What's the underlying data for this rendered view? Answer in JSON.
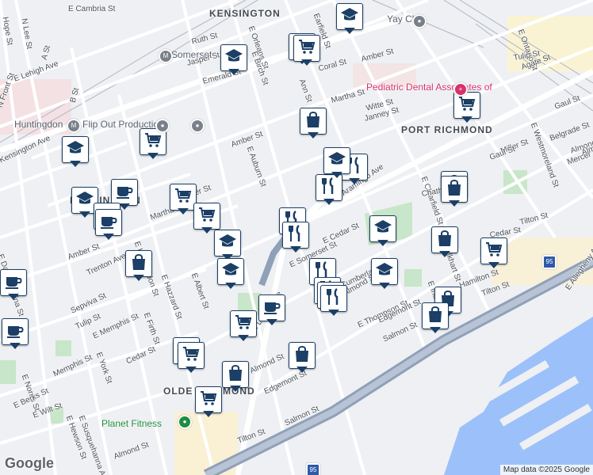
{
  "neighborhoods": [
    {
      "name": "KENSINGTON"
    },
    {
      "name": "PORT RICHMOND"
    },
    {
      "name": "KENSINGTON"
    },
    {
      "name": "OLDE RICHMOND"
    }
  ],
  "places": [
    {
      "name": "Somerset"
    },
    {
      "name": "Huntingdon"
    },
    {
      "name": "Flip Out Productions"
    },
    {
      "name": "Pediatric Dental Associates of"
    },
    {
      "name": "Yay Clay"
    },
    {
      "name": "Planet Fitness"
    }
  ],
  "streets": [
    {
      "name": "E Cambria St"
    },
    {
      "name": "N Lee St"
    },
    {
      "name": "Hope St"
    },
    {
      "name": "E Lehigh Ave"
    },
    {
      "name": "N Front St"
    },
    {
      "name": "B St"
    },
    {
      "name": "A St"
    },
    {
      "name": "Kensington Ave"
    },
    {
      "name": "Ruth St"
    },
    {
      "name": "Jasper St"
    },
    {
      "name": "Emerald St"
    },
    {
      "name": "E Orleans St"
    },
    {
      "name": "E Birch St"
    },
    {
      "name": "Coral St"
    },
    {
      "name": "Amber St"
    },
    {
      "name": "Earfield St"
    },
    {
      "name": "Ann St"
    },
    {
      "name": "E Ontario St"
    },
    {
      "name": "Tulip St"
    },
    {
      "name": "Agate St"
    },
    {
      "name": "Martha St"
    },
    {
      "name": "Witte St"
    },
    {
      "name": "Janney St"
    },
    {
      "name": "Gaul St"
    },
    {
      "name": "E Westmoreland St"
    },
    {
      "name": "Belgrade St"
    },
    {
      "name": "Almond St"
    },
    {
      "name": "Mercer St"
    },
    {
      "name": "Miller St"
    },
    {
      "name": "Aramingo Ave"
    },
    {
      "name": "E Auburn St"
    },
    {
      "name": "Amber St"
    },
    {
      "name": "Martha St"
    },
    {
      "name": "E Huntingdon St"
    },
    {
      "name": "Amber St"
    },
    {
      "name": "E Hazzard St"
    },
    {
      "name": "E Albert St"
    },
    {
      "name": "Trenton Ave"
    },
    {
      "name": "Sepviva St"
    },
    {
      "name": "Tulip St"
    },
    {
      "name": "E Firth St"
    },
    {
      "name": "E Memphis St"
    },
    {
      "name": "E York St"
    },
    {
      "name": "Cedar St"
    },
    {
      "name": "E Norris St"
    },
    {
      "name": "Memphis St"
    },
    {
      "name": "E Berks St"
    },
    {
      "name": "E Wilt St"
    },
    {
      "name": "E Hewson St"
    },
    {
      "name": "E Susquehanna Ave"
    },
    {
      "name": "E Dauphin St"
    },
    {
      "name": "E Arizona St"
    },
    {
      "name": "Almond St"
    },
    {
      "name": "E Cedar St"
    },
    {
      "name": "E Somerset St"
    },
    {
      "name": "E Cumberland St"
    },
    {
      "name": "E Thompson St"
    },
    {
      "name": "Edgemont St"
    },
    {
      "name": "Salmon St"
    },
    {
      "name": "Almond St"
    },
    {
      "name": "Edgemont St"
    },
    {
      "name": "Salmon St"
    },
    {
      "name": "Tilton St"
    },
    {
      "name": "E Lehigh Ave"
    },
    {
      "name": "E Indiana St"
    },
    {
      "name": "E Elkhart St"
    },
    {
      "name": "E Clearfield St"
    },
    {
      "name": "Tilton St"
    },
    {
      "name": "E Allegheny Ave"
    },
    {
      "name": "Almond St"
    },
    {
      "name": "Gaul St"
    },
    {
      "name": "Cedar St"
    },
    {
      "name": "Hamilton St"
    },
    {
      "name": "Tilton St"
    },
    {
      "name": "Almond St"
    },
    {
      "name": "Chatham St"
    },
    {
      "name": "Jasper St"
    }
  ],
  "highway": {
    "shield": "95"
  },
  "markers": [
    {
      "type": "school"
    },
    {
      "type": "shopping-cart"
    },
    {
      "type": "school"
    },
    {
      "type": "shopping-cart"
    },
    {
      "type": "shopping-bag"
    },
    {
      "type": "shopping-cart"
    },
    {
      "type": "school"
    },
    {
      "type": "restaurant"
    },
    {
      "type": "restaurant"
    },
    {
      "type": "shopping-bag"
    },
    {
      "type": "shopping-cart"
    },
    {
      "type": "school"
    },
    {
      "type": "shopping-cart"
    },
    {
      "type": "cafe"
    },
    {
      "type": "school"
    },
    {
      "type": "cafe"
    },
    {
      "type": "shopping-cart"
    },
    {
      "type": "restaurant"
    },
    {
      "type": "shopping-bag"
    },
    {
      "type": "school"
    },
    {
      "type": "school"
    },
    {
      "type": "restaurant"
    },
    {
      "type": "restaurant"
    },
    {
      "type": "school"
    },
    {
      "type": "shopping-bag"
    },
    {
      "type": "shopping-cart"
    },
    {
      "type": "school"
    },
    {
      "type": "cafe"
    },
    {
      "type": "restaurant"
    },
    {
      "type": "restaurant"
    },
    {
      "type": "restaurant"
    },
    {
      "type": "cafe"
    },
    {
      "type": "shopping-bag"
    },
    {
      "type": "shopping-bag"
    },
    {
      "type": "shopping-cart"
    },
    {
      "type": "shopping-bag"
    },
    {
      "type": "shopping-bag"
    },
    {
      "type": "shopping-cart"
    },
    {
      "type": "shopping-cart"
    },
    {
      "type": "cafe"
    },
    {
      "type": "cafe"
    },
    {
      "type": "shopping-bag"
    },
    {
      "type": "shopping-cart"
    }
  ],
  "attribution": "Map data ©2025 Google",
  "logo": "Google",
  "colors": {
    "land": "#eef0f3",
    "water": "#9cc0f9",
    "park": "#c8e6c9",
    "highway": "#8fa0b8",
    "pin_border": "#1b3f66",
    "pin_icon": "#1b3f66",
    "hospital": "#f8d7da"
  }
}
